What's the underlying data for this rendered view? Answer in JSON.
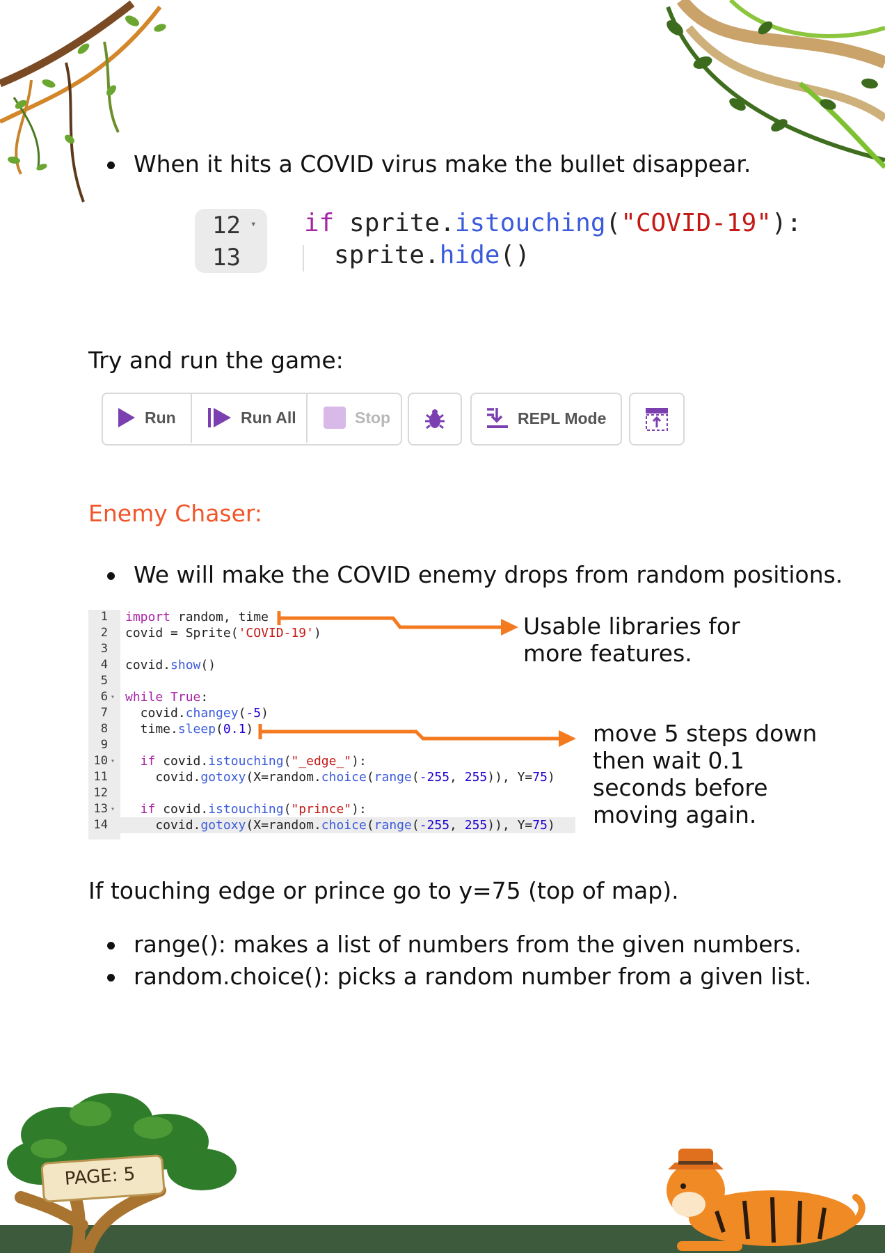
{
  "bullets_top": [
    "When it hits a COVID virus make the bullet disappear."
  ],
  "snippet1": {
    "lines": [
      {
        "num": "12",
        "code_kw": "if",
        "code_obj": " sprite.",
        "code_fn": "istouching",
        "code_open": "(",
        "code_str": "\"COVID-19\"",
        "code_close": "):"
      },
      {
        "num": "13",
        "code_obj": "sprite.",
        "code_fn": "hide",
        "code_rest": "()"
      }
    ]
  },
  "try_run": "Try and run the game:",
  "toolbar": {
    "run": "Run",
    "run_all": "Run All",
    "stop": "Stop",
    "repl": "REPL Mode"
  },
  "section_heading": "Enemy Chaser:",
  "bullet_enemy": "We will make the COVID enemy drops from random positions.",
  "code": {
    "line_numbers": [
      "1",
      "2",
      "3",
      "4",
      "5",
      "6",
      "7",
      "8",
      "9",
      "10",
      "11",
      "12",
      "13",
      "14"
    ],
    "l1_kw": "import",
    "l1_rest": " random, time",
    "l2_a": "covid = Sprite(",
    "l2_str": "'COVID-19'",
    "l2_b": ")",
    "l4_a": "covid.",
    "l4_fn": "show",
    "l4_b": "()",
    "l6_kw": "while",
    "l6_kw2": " True",
    "l6_b": ":",
    "l7_a": "  covid.",
    "l7_fn": "changey",
    "l7_b": "(",
    "l7_num": "-5",
    "l7_c": ")",
    "l8_a": "  time.",
    "l8_fn": "sleep",
    "l8_b": "(",
    "l8_num": "0.1",
    "l8_c": ")",
    "l10_kw": "  if",
    "l10_a": " covid.",
    "l10_fn": "istouching",
    "l10_b": "(",
    "l10_str": "\"_edge_\"",
    "l10_c": "):",
    "l11_a": "    covid.",
    "l11_fn": "gotoxy",
    "l11_b": "(X=random.",
    "l11_fn2": "choice",
    "l11_c": "(",
    "l11_fn3": "range",
    "l11_d": "(",
    "l11_n1": "-255",
    "l11_e": ", ",
    "l11_n2": "255",
    "l11_f": ")), Y=",
    "l11_n3": "75",
    "l11_g": ")",
    "l13_kw": "  if",
    "l13_a": " covid.",
    "l13_fn": "istouching",
    "l13_b": "(",
    "l13_str": "\"prince\"",
    "l13_c": "):",
    "l14_a": "    covid.",
    "l14_fn": "gotoxy",
    "l14_b": "(X=random.",
    "l14_fn2": "choice",
    "l14_c": "(",
    "l14_fn3": "range",
    "l14_d": "(",
    "l14_n1": "-255",
    "l14_e": ", ",
    "l14_n2": "255",
    "l14_f": ")), Y=",
    "l14_n3": "75",
    "l14_g": ")"
  },
  "note_libraries": "Usable libraries for more features.",
  "note_move": "move 5 steps down then wait 0.1 seconds before moving again.",
  "edge_text": "If touching edge or prince go to y=75 (top of map).",
  "bullets_bottom": [
    "range(): makes a list of numbers from the given numbers.",
    "random.choice(): picks a random number from a given list."
  ],
  "page_label": "PAGE: 5",
  "colors": {
    "heading": "#f0562a",
    "arrow": "#f47a20",
    "toolbar_purple": "#7b3fb0",
    "ground": "#3e5a3c"
  }
}
